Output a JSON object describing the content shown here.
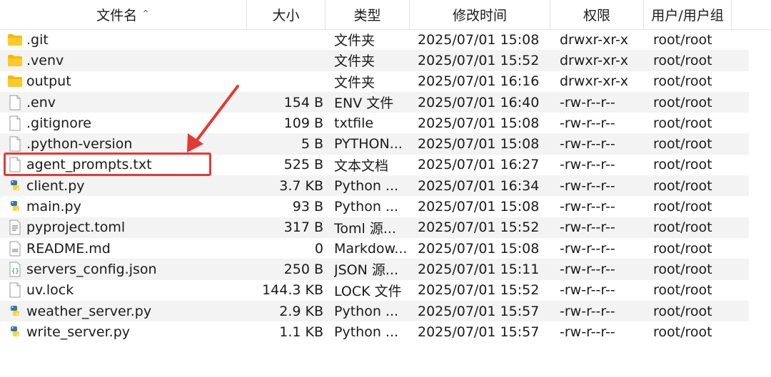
{
  "columns": {
    "name": "文件名",
    "size": "大小",
    "type": "类型",
    "modified": "修改时间",
    "permissions": "权限",
    "owner": "用户/用户组"
  },
  "files": [
    {
      "icon": "folder-icon",
      "name": ".git",
      "size": "",
      "type": "文件夹",
      "modified": "2025/07/01 15:08",
      "permissions": "drwxr-xr-x",
      "owner": "root/root"
    },
    {
      "icon": "folder-icon",
      "name": ".venv",
      "size": "",
      "type": "文件夹",
      "modified": "2025/07/01 15:52",
      "permissions": "drwxr-xr-x",
      "owner": "root/root"
    },
    {
      "icon": "folder-icon",
      "name": "output",
      "size": "",
      "type": "文件夹",
      "modified": "2025/07/01 16:16",
      "permissions": "drwxr-xr-x",
      "owner": "root/root"
    },
    {
      "icon": "file-icon",
      "name": ".env",
      "size": "154 B",
      "type": "ENV 文件",
      "modified": "2025/07/01 16:40",
      "permissions": "-rw-r--r--",
      "owner": "root/root"
    },
    {
      "icon": "file-icon",
      "name": ".gitignore",
      "size": "109 B",
      "type": "txtfile",
      "modified": "2025/07/01 15:08",
      "permissions": "-rw-r--r--",
      "owner": "root/root"
    },
    {
      "icon": "file-icon",
      "name": ".python-version",
      "size": "5 B",
      "type": "PYTHON...",
      "modified": "2025/07/01 15:08",
      "permissions": "-rw-r--r--",
      "owner": "root/root"
    },
    {
      "icon": "text-file-icon",
      "name": "agent_prompts.txt",
      "size": "525 B",
      "type": "文本文档",
      "modified": "2025/07/01 16:27",
      "permissions": "-rw-r--r--",
      "owner": "root/root"
    },
    {
      "icon": "python-file-icon",
      "name": "client.py",
      "size": "3.7 KB",
      "type": "Python ...",
      "modified": "2025/07/01 16:34",
      "permissions": "-rw-r--r--",
      "owner": "root/root"
    },
    {
      "icon": "python-file-icon",
      "name": "main.py",
      "size": "93 B",
      "type": "Python ...",
      "modified": "2025/07/01 15:08",
      "permissions": "-rw-r--r--",
      "owner": "root/root"
    },
    {
      "icon": "toml-file-icon",
      "name": "pyproject.toml",
      "size": "317 B",
      "type": "Toml 源...",
      "modified": "2025/07/01 15:52",
      "permissions": "-rw-r--r--",
      "owner": "root/root"
    },
    {
      "icon": "markdown-file-icon",
      "name": "README.md",
      "size": "0",
      "type": "Markdow...",
      "modified": "2025/07/01 15:08",
      "permissions": "-rw-r--r--",
      "owner": "root/root"
    },
    {
      "icon": "json-file-icon",
      "name": "servers_config.json",
      "size": "250 B",
      "type": "JSON 源...",
      "modified": "2025/07/01 15:11",
      "permissions": "-rw-r--r--",
      "owner": "root/root"
    },
    {
      "icon": "file-icon",
      "name": "uv.lock",
      "size": "144.3 KB",
      "type": "LOCK 文件",
      "modified": "2025/07/01 15:52",
      "permissions": "-rw-r--r--",
      "owner": "root/root"
    },
    {
      "icon": "python-file-icon",
      "name": "weather_server.py",
      "size": "2.9 KB",
      "type": "Python ...",
      "modified": "2025/07/01 15:57",
      "permissions": "-rw-r--r--",
      "owner": "root/root"
    },
    {
      "icon": "python-file-icon",
      "name": "write_server.py",
      "size": "1.1 KB",
      "type": "Python ...",
      "modified": "2025/07/01 15:57",
      "permissions": "-rw-r--r--",
      "owner": "root/root"
    }
  ],
  "annotation": {
    "highlighted_file": "agent_prompts.txt",
    "color": "#e53935"
  },
  "colors": {
    "folder": "#f5b800",
    "python_blue": "#3776ab",
    "python_yellow": "#ffd43b",
    "row_alt": "#f3f3f3"
  }
}
